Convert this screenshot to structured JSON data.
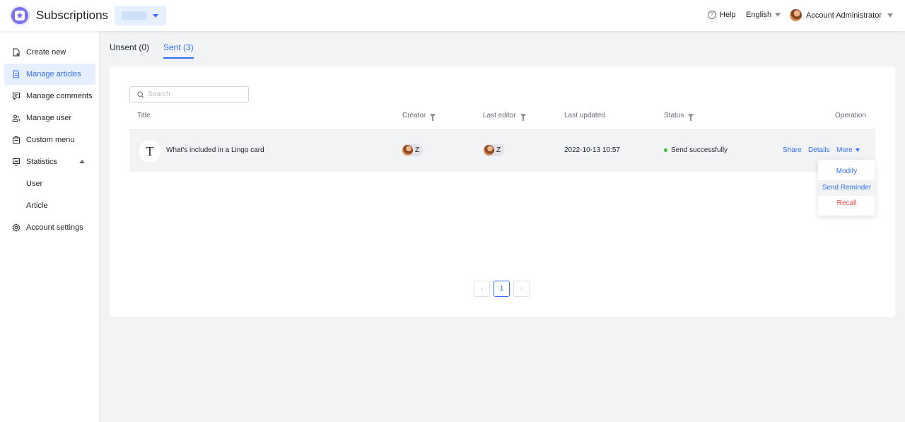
{
  "header": {
    "app_title": "Subscriptions",
    "help_label": "Help",
    "language": "English",
    "account_name": "Account Administrator"
  },
  "sidebar": {
    "items": [
      {
        "label": "Create new",
        "icon": "file-plus-icon"
      },
      {
        "label": "Manage articles",
        "icon": "document-icon",
        "active": true
      },
      {
        "label": "Manage comments",
        "icon": "comment-icon"
      },
      {
        "label": "Manage user",
        "icon": "users-icon"
      },
      {
        "label": "Custom menu",
        "icon": "menu-box-icon"
      },
      {
        "label": "Statistics",
        "icon": "chart-icon",
        "expanded": true
      },
      {
        "label": "User",
        "sub": true
      },
      {
        "label": "Article",
        "sub": true
      },
      {
        "label": "Account settings",
        "icon": "gear-icon"
      }
    ]
  },
  "tabs": [
    {
      "label": "Unsent (0)"
    },
    {
      "label": "Sent (3)",
      "active": true
    }
  ],
  "search": {
    "placeholder": "Search"
  },
  "table": {
    "columns": [
      "Title",
      "Creator",
      "Last editor",
      "Last updated",
      "Status",
      "Operation"
    ],
    "rows": [
      {
        "icon_letter": "T",
        "title": "What's included in a Lingo card",
        "creator": "Z",
        "last_editor": "Z",
        "last_updated": "2022-10-13 10:57",
        "status": "Send successfully",
        "ops": [
          "Share",
          "Details",
          "More"
        ]
      }
    ]
  },
  "more_menu": [
    "Modify",
    "Send Reminder",
    "Recall"
  ],
  "pagination": {
    "current": "1",
    "prev": "‹",
    "next": "›"
  },
  "colors": {
    "accent": "#3370ff",
    "danger": "#f54a45",
    "success": "#34c724",
    "brand": "#7a6ff0"
  }
}
